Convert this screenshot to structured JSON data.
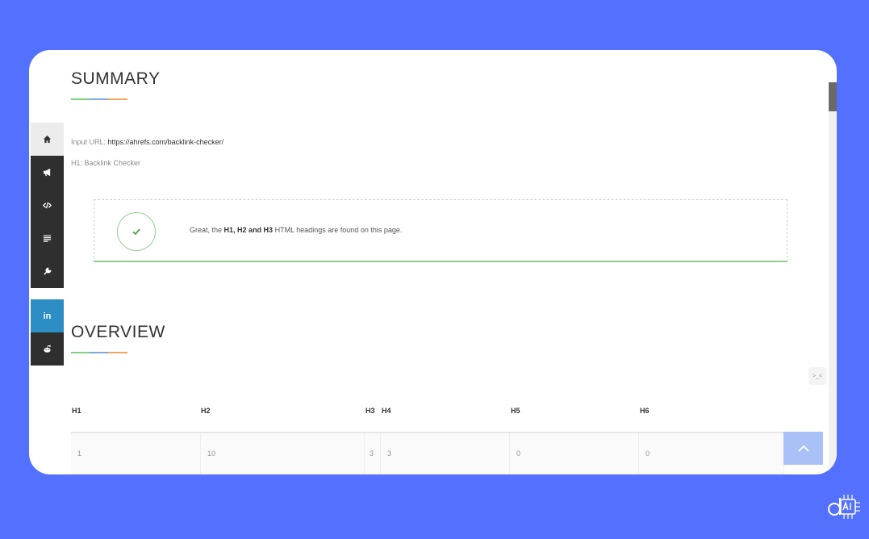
{
  "summary": {
    "title": "SUMMARY",
    "input_url_label": "Input URL:",
    "input_url_value": "https://ahrefs.com/backlink-checker/",
    "h1_line": "H1: Backlink Checker"
  },
  "alert": {
    "prefix": "Great, the",
    "bold": "H1, H2 and H3",
    "suffix": "HTML headings are found on this page."
  },
  "overview": {
    "title": "OVERVIEW",
    "headers": [
      "H1",
      "H2",
      "H3",
      "H4",
      "H5",
      "H6"
    ],
    "values": [
      "1",
      "10",
      "3",
      "3",
      "0",
      "0"
    ]
  },
  "sidebar": {
    "items": [
      "home-icon",
      "megaphone-icon",
      "code-icon",
      "list-icon",
      "wrench-icon",
      "linkedin-icon",
      "reddit-icon"
    ],
    "linkedin_label": "in"
  },
  "widget": {
    "label": ">_<"
  },
  "colors": {
    "background": "#5470fe",
    "success": "#8fd08f",
    "linkedin": "#2c8ec5",
    "back_to_top": "#a9c1f7"
  }
}
